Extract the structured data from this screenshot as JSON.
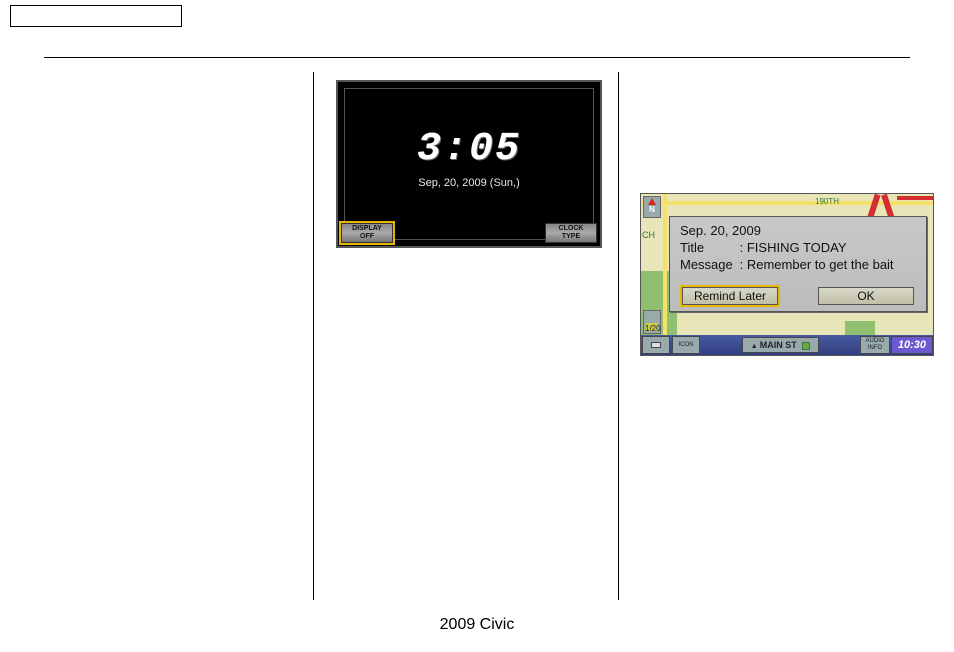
{
  "footer_text": "2009  Civic",
  "clock": {
    "time": "3:05",
    "date": "Sep, 20, 2009 (Sun,)",
    "display_off_line1": "DISPLAY",
    "display_off_line2": "OFF",
    "clock_type_line1": "CLOCK",
    "clock_type_line2": "TYPE"
  },
  "map": {
    "north": "N",
    "hwy_label": "190TH",
    "zoom_dist": "1/20",
    "street": "MAIN ST",
    "audio_line1": "AUDIO",
    "audio_line2": "INFO",
    "icon_line1": "ICON",
    "clock": "10:30",
    "popup": {
      "date": "Sep. 20, 2009",
      "title_label": "Title",
      "title_value": "FISHING TODAY",
      "message_label": "Message",
      "message_value": "Remember to get the bait",
      "remind_label": "Remind Later",
      "ok_label": "OK"
    }
  }
}
